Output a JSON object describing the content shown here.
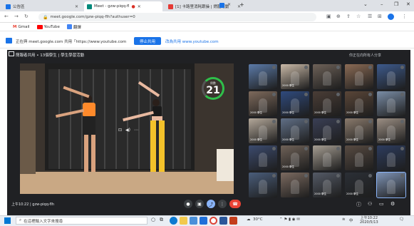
{
  "tabs": [
    {
      "title": "公告區",
      "color": "#1a73e8"
    },
    {
      "title": "Meet - gzw-piqq-fl",
      "color": "#00897b"
    },
    {
      "title": "[1] 卡路里消耗跟操 | 燃脂運動",
      "color": "#e53935"
    }
  ],
  "address": {
    "url": "meet.google.com/gzw-piqq-flh?authuser=0"
  },
  "bookmarks": [
    {
      "label": "Gmail",
      "icon": "gmail-icon",
      "color": "#ea4335"
    },
    {
      "label": "YouTube",
      "icon": "youtube-icon",
      "color": "#ff0000"
    },
    {
      "label": "翻譯",
      "icon": "translate-icon",
      "color": "#4285f4"
    }
  ],
  "share_banner": {
    "text": "正在與 meet.google.com 共用「https://www.youtube.com",
    "share_button": "停止共用",
    "cancel_button": "改為共用 www.youtube.com"
  },
  "meet": {
    "header": "簡報者共用 • 13個學生 | 學生學習活動",
    "header_right": "你正在向所有人分享",
    "counter_label": "倒數",
    "counter_value": "21",
    "footer": "上午10:22 | gzw-piqq-flh",
    "participants": [
      {
        "label": "",
        "color": "#5b7aa8"
      },
      {
        "label": "2000 學生",
        "color": "#c9b9a7"
      },
      {
        "label": "",
        "color": "#6d6158"
      },
      {
        "label": "",
        "color": "#8b6b55"
      },
      {
        "label": "",
        "color": "#3d5a8c"
      },
      {
        "label": "2000 學生",
        "color": "#7e6a5c"
      },
      {
        "label": "2000 學生",
        "color": "#2f4a7d"
      },
      {
        "label": "2000 學生",
        "color": "#4a3d36"
      },
      {
        "label": "2000 學生",
        "color": "#5a4638"
      },
      {
        "label": "",
        "color": "#7a8da6"
      },
      {
        "label": "2000 學生",
        "color": "#b4a89a"
      },
      {
        "label": "2000 學生",
        "color": "#606f86"
      },
      {
        "label": "2000 學生",
        "color": "#3a3f55"
      },
      {
        "label": "2000 學生",
        "color": "#8a7a6c"
      },
      {
        "label": "2000 學生",
        "color": "#9c8f84"
      },
      {
        "label": "",
        "color": "#3c4b6e"
      },
      {
        "label": "2000 學生",
        "color": "#6f6258"
      },
      {
        "label": "",
        "color": "#a59d92"
      },
      {
        "label": "",
        "color": "#584b42"
      },
      {
        "label": "",
        "color": "#2d3c5e"
      },
      {
        "label": "",
        "color": "#4a5d7a"
      },
      {
        "label": "",
        "color": "#7b6a60"
      },
      {
        "label": "2000 學生",
        "color": "#545a66"
      },
      {
        "label": "2000 學生",
        "color": "#2b2f36"
      },
      {
        "label": "",
        "color": "#7e93b5"
      }
    ]
  },
  "taskbar": {
    "search_placeholder": "在這裡輸入文字來搜尋",
    "weather": "30°C",
    "time": "上午10:22",
    "date": "2020/5/13"
  }
}
